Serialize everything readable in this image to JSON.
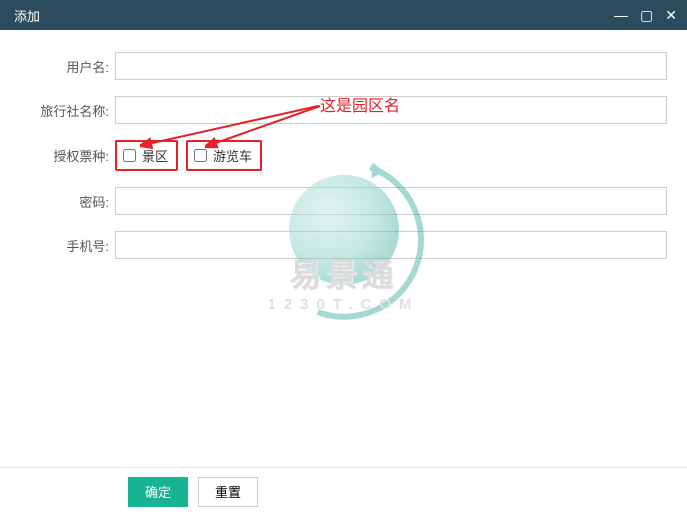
{
  "window": {
    "title": "添加"
  },
  "form": {
    "fields": {
      "username": {
        "label": "用户名:",
        "value": ""
      },
      "agency": {
        "label": "旅行社名称:",
        "value": ""
      },
      "ticket": {
        "label": "授权票种:"
      },
      "password": {
        "label": "密码:",
        "value": ""
      },
      "phone": {
        "label": "手机号:",
        "value": ""
      }
    },
    "checkboxes": [
      {
        "label": "景区",
        "checked": false
      },
      {
        "label": "游览车",
        "checked": false
      }
    ]
  },
  "annotation": {
    "text": "这是园区名"
  },
  "watermark": {
    "brand": "易景通",
    "sub": "1230T.COM"
  },
  "footer": {
    "confirm": "确定",
    "reset": "重置"
  }
}
